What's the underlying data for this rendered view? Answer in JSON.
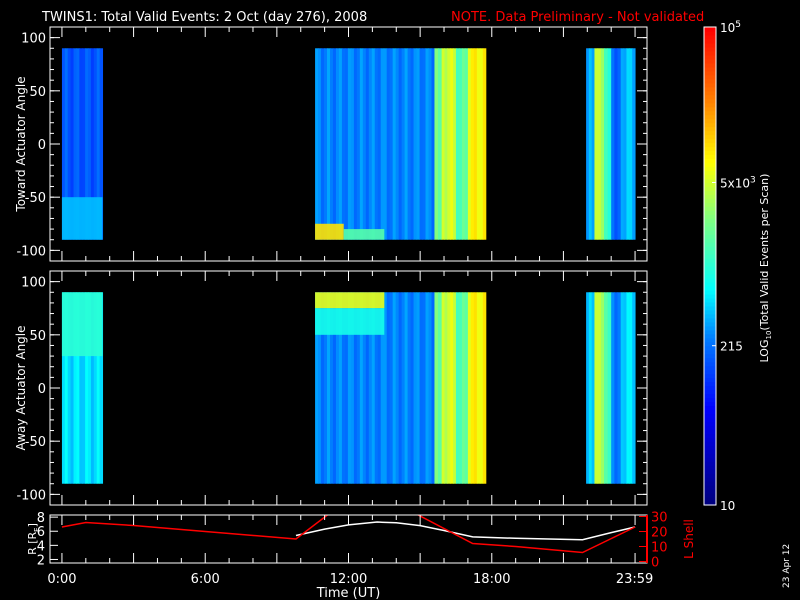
{
  "header": {
    "title": "TWINS1: Total Valid Events:  2 Oct (day 276), 2008",
    "note": "NOTE. Data Preliminary - Not validated",
    "note_color": "#ff0000"
  },
  "side_date": "23 Apr 12",
  "chart_data": [
    {
      "type": "heatmap",
      "name": "toward",
      "ylabel": "Toward Actuator Angle",
      "ylim": [
        -110,
        110
      ],
      "yticks": [
        "100",
        "50",
        "0",
        "-50",
        "-100"
      ],
      "ytick_values": [
        100,
        50,
        0,
        -50,
        -100
      ],
      "angle_range": [
        -90,
        90
      ],
      "segments": [
        {
          "t0": 0.0,
          "t1": 1.7,
          "value": 2.2
        },
        {
          "t0": 10.6,
          "t1": 15.6,
          "value": 2.4
        },
        {
          "t0": 15.6,
          "t1": 15.9,
          "value": 3.3
        },
        {
          "t0": 15.9,
          "t1": 16.5,
          "value": 3.7
        },
        {
          "t0": 16.5,
          "t1": 17.0,
          "value": 3.2
        },
        {
          "t0": 17.0,
          "t1": 17.75,
          "value": 3.9
        },
        {
          "t0": 21.95,
          "t1": 22.3,
          "value": 2.5
        },
        {
          "t0": 22.3,
          "t1": 22.7,
          "value": 3.6
        },
        {
          "t0": 22.7,
          "t1": 23.0,
          "value": 3.0
        },
        {
          "t0": 23.0,
          "t1": 23.4,
          "value": 2.3
        },
        {
          "t0": 23.4,
          "t1": 24.0,
          "value": 2.6
        }
      ],
      "features": [
        {
          "t0": 10.6,
          "t1": 11.8,
          "a0": -90,
          "a1": -75,
          "value": 4.0
        },
        {
          "t0": 11.8,
          "t1": 13.5,
          "a0": -90,
          "a1": -80,
          "value": 3.2
        },
        {
          "t0": 0.0,
          "t1": 1.7,
          "a0": -90,
          "a1": -50,
          "value": 2.6
        }
      ]
    },
    {
      "type": "heatmap",
      "name": "away",
      "ylabel": "Away Actuator Angle",
      "ylim": [
        -110,
        110
      ],
      "yticks": [
        "100",
        "50",
        "0",
        "-50",
        "-100"
      ],
      "ytick_values": [
        100,
        50,
        0,
        -50,
        -100
      ],
      "angle_range": [
        -90,
        90
      ],
      "segments": [
        {
          "t0": 0.0,
          "t1": 1.7,
          "value": 2.7
        },
        {
          "t0": 10.6,
          "t1": 15.6,
          "value": 2.4
        },
        {
          "t0": 15.6,
          "t1": 15.9,
          "value": 3.3
        },
        {
          "t0": 15.9,
          "t1": 16.5,
          "value": 3.7
        },
        {
          "t0": 16.5,
          "t1": 17.0,
          "value": 3.2
        },
        {
          "t0": 17.0,
          "t1": 17.75,
          "value": 3.9
        },
        {
          "t0": 21.95,
          "t1": 22.3,
          "value": 2.6
        },
        {
          "t0": 22.3,
          "t1": 22.7,
          "value": 3.6
        },
        {
          "t0": 22.7,
          "t1": 23.0,
          "value": 3.1
        },
        {
          "t0": 23.0,
          "t1": 23.4,
          "value": 2.4
        },
        {
          "t0": 23.4,
          "t1": 24.0,
          "value": 2.7
        }
      ],
      "features": [
        {
          "t0": 10.6,
          "t1": 13.5,
          "a0": 75,
          "a1": 90,
          "value": 3.8
        },
        {
          "t0": 10.6,
          "t1": 13.5,
          "a0": 50,
          "a1": 75,
          "value": 2.9
        },
        {
          "t0": 0.0,
          "t1": 1.7,
          "a0": 30,
          "a1": 90,
          "value": 3.0
        }
      ]
    },
    {
      "type": "line",
      "name": "orbit",
      "ylabel": "R [R",
      "ylabel_sub": "E",
      "ylabel_close": "]",
      "ylim": [
        1.5,
        8.3
      ],
      "yticks": [
        "8",
        "6",
        "4",
        "2"
      ],
      "ytick_values": [
        8,
        6,
        4,
        2
      ],
      "y2label": "L Shell",
      "y2lim": [
        -1,
        31
      ],
      "y2ticks": [
        "30",
        "20",
        "10",
        "0"
      ],
      "y2tick_values": [
        30,
        20,
        10,
        0
      ],
      "xlabel": "Time (UT)",
      "xlim": [
        -0.5,
        24.5
      ],
      "xticks": [
        "0:00",
        "6:00",
        "12:00",
        "18:00",
        "23:59"
      ],
      "xtick_values": [
        0,
        6,
        12,
        18,
        23.98
      ],
      "series": [
        {
          "name": "R",
          "color": "#ffffff",
          "x": [
            9.8,
            11,
            12,
            13.2,
            14,
            15,
            16,
            17.2,
            19,
            21.8,
            23,
            24
          ],
          "y": [
            5.4,
            6.3,
            6.9,
            7.3,
            7.2,
            6.8,
            6.1,
            5.2,
            5.0,
            4.8,
            5.8,
            6.6
          ]
        },
        {
          "name": "L Shell",
          "color": "#ff0000",
          "axis": "right",
          "x": [
            0,
            1,
            3,
            6,
            9.8,
            11.2
          ],
          "y": [
            23,
            26,
            24,
            20,
            15,
            32
          ]
        },
        {
          "name": "L Shell b",
          "color": "#ff0000",
          "axis": "right",
          "x": [
            14.8,
            17.2,
            19,
            21.8,
            24
          ],
          "y": [
            32,
            12,
            10,
            6,
            23
          ]
        }
      ]
    }
  ],
  "colorbar": {
    "label": "LOG",
    "label_sub": "10",
    "label_rest": "(Total Valid  Events per Scan)",
    "log_range": [
      1,
      5
    ],
    "ticks": [
      {
        "label": "10",
        "log": 1
      },
      {
        "label": "215",
        "log": 2.333
      },
      {
        "label": "5x10",
        "sup": "3",
        "log": 3.699
      },
      {
        "label": "10",
        "sup": "5",
        "log": 5
      }
    ]
  }
}
